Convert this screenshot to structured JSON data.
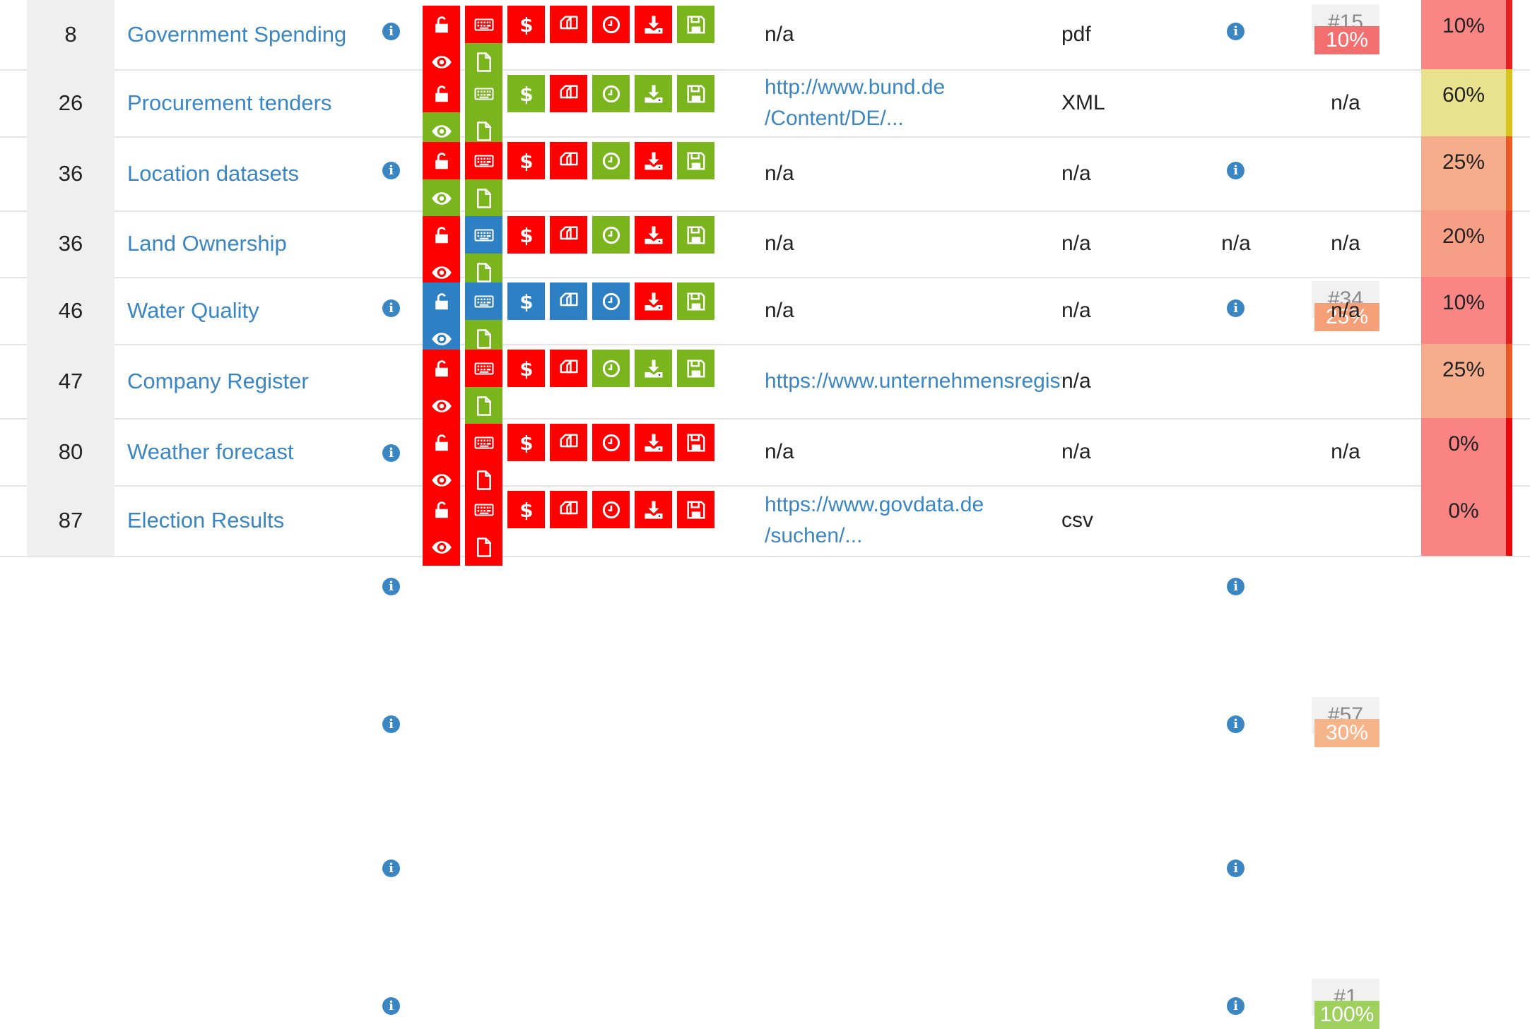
{
  "colors": {
    "red": "#ff0000",
    "green": "#7ab51d",
    "blue": "#2d80c4",
    "link": "#3a86c3"
  },
  "rows": [
    {
      "rank": "8",
      "name": "Government Spending",
      "icons": {
        "open_license": "red",
        "machine_readable": "red",
        "free": "red",
        "bulk": "red",
        "timely": "red",
        "online": "red",
        "updated": "green",
        "public": "red",
        "exists": "green"
      },
      "link": "n/a",
      "link_line2": "",
      "format": "pdf",
      "license": "info-icon",
      "rank_badge": "#15",
      "rank_score": "10%",
      "rank_score_color": "#f36f6f",
      "score": "10%",
      "score_color": "#f98585",
      "bar_color": "#e5231e"
    },
    {
      "rank": "26",
      "name": "Procurement tenders",
      "icons": {
        "open_license": "red",
        "machine_readable": "green",
        "free": "green",
        "bulk": "red",
        "timely": "green",
        "online": "green",
        "updated": "green",
        "public": "green",
        "exists": "green"
      },
      "link": "http://www.bund.de",
      "link_line2": "/Content/DE/...",
      "format": "XML",
      "license": "info-icon",
      "rank_badge": "",
      "rank_score": "n/a",
      "rank_score_color": "",
      "score": "60%",
      "score_color": "#e8e28f",
      "bar_color": "#d6c41a"
    },
    {
      "rank": "36",
      "name": "Location datasets",
      "icons": {
        "open_license": "red",
        "machine_readable": "red",
        "free": "red",
        "bulk": "red",
        "timely": "green",
        "online": "red",
        "updated": "green",
        "public": "green",
        "exists": "green"
      },
      "link": "n/a",
      "link_line2": "",
      "format": "n/a",
      "license": "info-icon",
      "rank_badge": "#34",
      "rank_score": "25%",
      "rank_score_color": "#f6a07a",
      "score": "25%",
      "score_color": "#f6ad8c",
      "bar_color": "#ec5b24"
    },
    {
      "rank": "36",
      "name": "Land Ownership",
      "icons": {
        "open_license": "red",
        "machine_readable": "blue",
        "free": "red",
        "bulk": "red",
        "timely": "green",
        "online": "red",
        "updated": "green",
        "public": "red",
        "exists": "green"
      },
      "link": "n/a",
      "link_line2": "",
      "format": "n/a",
      "license": "n/a",
      "rank_badge": "",
      "rank_score": "n/a",
      "rank_score_color": "",
      "score": "20%",
      "score_color": "#f69f86",
      "bar_color": "#ea4124"
    },
    {
      "rank": "46",
      "name": "Water Quality",
      "icons": {
        "open_license": "blue",
        "machine_readable": "blue",
        "free": "blue",
        "bulk": "blue",
        "timely": "blue",
        "online": "red",
        "updated": "green",
        "public": "blue",
        "exists": "green"
      },
      "link": "n/a",
      "link_line2": "",
      "format": "n/a",
      "license": "info-icon",
      "rank_badge": "",
      "rank_score": "n/a",
      "rank_score_color": "",
      "score": "10%",
      "score_color": "#f98585",
      "bar_color": "#e5231e"
    },
    {
      "rank": "47",
      "name": "Company Register",
      "icons": {
        "open_license": "red",
        "machine_readable": "red",
        "free": "red",
        "bulk": "red",
        "timely": "green",
        "online": "green",
        "updated": "green",
        "public": "red",
        "exists": "green"
      },
      "link": "https://www.unternehmensregister.de",
      "link_line2": "",
      "format": "n/a",
      "license": "info-icon",
      "rank_badge": "#57",
      "rank_score": "30%",
      "rank_score_color": "#f6b48a",
      "score": "25%",
      "score_color": "#f6ad8c",
      "bar_color": "#ec5b24"
    },
    {
      "rank": "80",
      "name": "Weather forecast",
      "icons": {
        "open_license": "red",
        "machine_readable": "red",
        "free": "red",
        "bulk": "red",
        "timely": "red",
        "online": "red",
        "updated": "red",
        "public": "red",
        "exists": "red"
      },
      "link": "n/a",
      "link_line2": "",
      "format": "n/a",
      "license": "info-icon",
      "rank_badge": "",
      "rank_score": "n/a",
      "rank_score_color": "",
      "score": "0%",
      "score_color": "#fa8383",
      "bar_color": "#e50b0b"
    },
    {
      "rank": "87",
      "name": "Election Results",
      "icons": {
        "open_license": "red",
        "machine_readable": "red",
        "free": "red",
        "bulk": "red",
        "timely": "red",
        "online": "red",
        "updated": "red",
        "public": "red",
        "exists": "red"
      },
      "link": "https://www.govdata.de",
      "link_line2": "/suchen/...",
      "format": "csv",
      "license": "info-icon",
      "rank_badge": "#1",
      "rank_score": "100%",
      "rank_score_color": "#9fcf5c",
      "score": "0%",
      "score_color": "#fa8383",
      "bar_color": "#e50b0b"
    }
  ]
}
